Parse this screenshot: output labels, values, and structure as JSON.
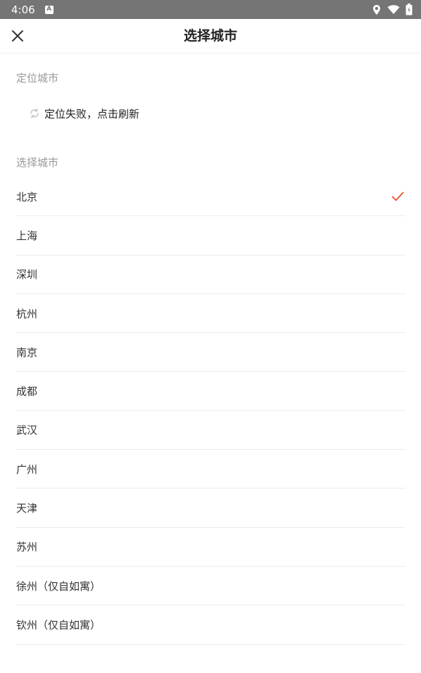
{
  "status_bar": {
    "time": "4:06",
    "a_icon_label": "A"
  },
  "header": {
    "title": "选择城市"
  },
  "location_section": {
    "label": "定位城市",
    "status_text": "定位失败，点击刷新"
  },
  "city_section": {
    "label": "选择城市",
    "selected_index": 0,
    "cities": [
      {
        "name": "北京",
        "selected": true
      },
      {
        "name": "上海",
        "selected": false
      },
      {
        "name": "深圳",
        "selected": false
      },
      {
        "name": "杭州",
        "selected": false
      },
      {
        "name": "南京",
        "selected": false
      },
      {
        "name": "成都",
        "selected": false
      },
      {
        "name": "武汉",
        "selected": false
      },
      {
        "name": "广州",
        "selected": false
      },
      {
        "name": "天津",
        "selected": false
      },
      {
        "name": "苏州",
        "selected": false
      },
      {
        "name": "徐州（仅自如寓）",
        "selected": false
      },
      {
        "name": "钦州（仅自如寓）",
        "selected": false
      }
    ]
  },
  "colors": {
    "accent": "#e8542c",
    "status_bar": "#757575",
    "muted_text": "#999999"
  },
  "icons": [
    "location-pin-icon",
    "wifi-icon",
    "battery-icon",
    "close-icon",
    "refresh-icon",
    "checkmark-icon"
  ]
}
